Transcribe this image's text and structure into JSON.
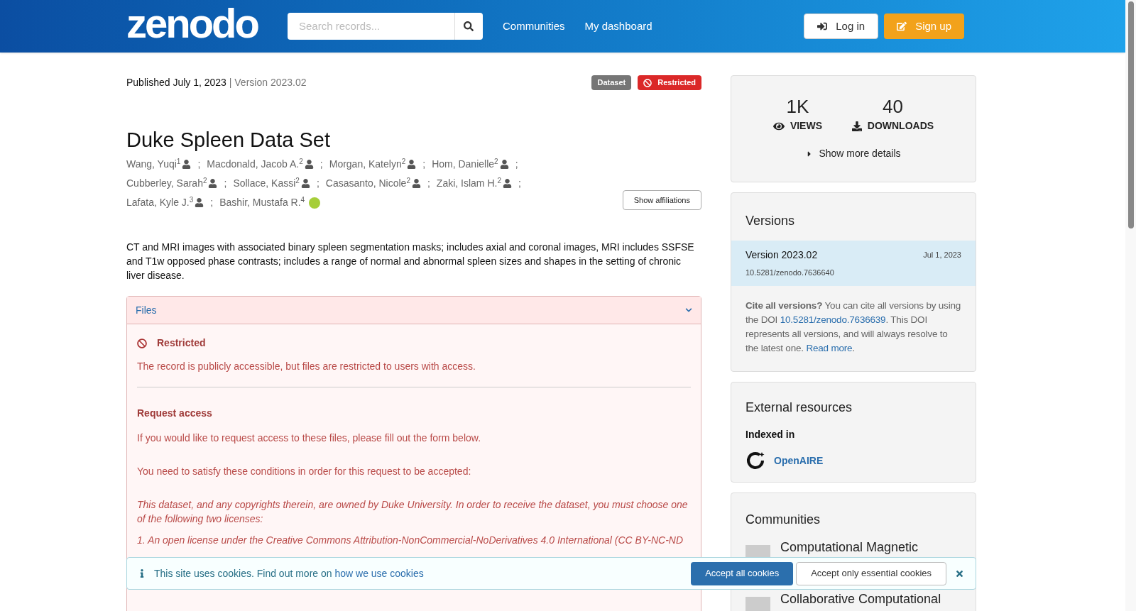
{
  "header": {
    "logo": "zenodo",
    "search": {
      "placeholder": "Search records..."
    },
    "nav": [
      "Communities",
      "My dashboard"
    ],
    "buttons": [
      {
        "kind": "login",
        "label": "Log in"
      },
      {
        "kind": "signup",
        "label": "Sign up"
      }
    ]
  },
  "record": {
    "published": "Published July 1, 2023",
    "version_separator": "|",
    "version": "Version 2023.02",
    "badges": [
      {
        "kind": "type",
        "label": "Dataset"
      },
      {
        "kind": "restricted",
        "label": "Restricted"
      }
    ],
    "title": "Duke Spleen Data Set",
    "authors": [
      {
        "name": "Wang, Yuqi",
        "sup": "1",
        "kind": "person"
      },
      {
        "name": "Macdonald, Jacob A.",
        "sup": "2",
        "kind": "person"
      },
      {
        "name": "Morgan, Katelyn",
        "sup": "2",
        "kind": "person"
      },
      {
        "name": "Hom, Danielle",
        "sup": "2",
        "kind": "person"
      },
      {
        "name": "Cubberley, Sarah",
        "sup": "2",
        "kind": "person"
      },
      {
        "name": "Sollace, Kassi",
        "sup": "2",
        "kind": "person"
      },
      {
        "name": "Casasanto, Nicole",
        "sup": "2",
        "kind": "person"
      },
      {
        "name": "Zaki, Islam H.",
        "sup": "2",
        "kind": "person"
      },
      {
        "name": "Lafata, Kyle J.",
        "sup": "3",
        "kind": "person"
      },
      {
        "name": "Bashir, Mustafa R.",
        "sup": "4",
        "kind": "orcid"
      }
    ],
    "separator": ";",
    "show_affiliations": "Show affiliations",
    "description": "CT and MRI images with associated binary spleen segmentation masks; includes axial and coronal images, MRI includes SSFSE and T1w opposed phase contrasts; includes a range of normal and abnormal spleen sizes and shapes in the setting of chronic liver disease."
  },
  "files": {
    "title": "Files",
    "expanded": true,
    "restricted_title": "Restricted",
    "restricted_text": "The record is publicly accessible, but files are restricted to users with access.",
    "request_title": "Request access",
    "request_text": "If you would like to request access to these files, please fill out the form below.",
    "conditions_intro": "You need to satisfy these conditions in order for this request to be accepted:",
    "conditions": [
      "This dataset, and any copyrights therein, are owned by Duke University. In order to receive the dataset, you must choose one of the following two licenses:",
      "1. An open license under the Creative Commons Attribution-NonCommercial-NoDerivatives 4.0 International (CC BY-NC-ND"
    ]
  },
  "stats": {
    "views": "1K",
    "views_label": "VIEWS",
    "downloads": "40",
    "downloads_label": "DOWNLOADS",
    "more": "Show more details"
  },
  "versions": {
    "title": "Versions",
    "items": [
      {
        "label": "Version 2023.02",
        "date": "Jul 1, 2023",
        "doi": "10.5281/zenodo.7636640",
        "selected": true
      }
    ],
    "cite_bold": "Cite all versions?",
    "cite_1": " You can cite all versions by using the DOI ",
    "cite_doi": "10.5281/zenodo.7636639",
    "cite_2": ". This DOI represents all versions, and will always resolve to the latest one. ",
    "read_more": "Read more",
    "cite_end": "."
  },
  "external": {
    "title": "External resources",
    "indexed": "Indexed in",
    "link": "OpenAIRE"
  },
  "communities": {
    "title": "Communities",
    "items": [
      "Computational Magnetic",
      "Collaborative Computational"
    ]
  },
  "cookies": {
    "text": "This site uses cookies. Find out more on ",
    "link": "how we use cookies",
    "accept_all": "Accept all cookies",
    "accept_essential": "Accept only essential cookies"
  }
}
